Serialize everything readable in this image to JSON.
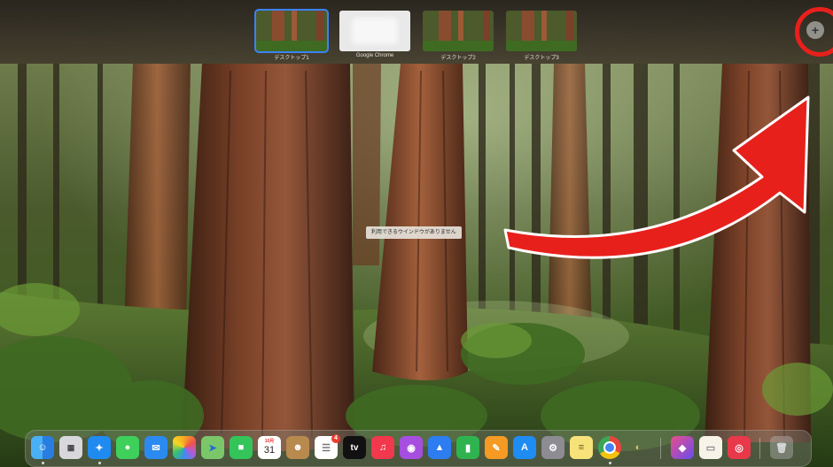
{
  "spaces_bar": {
    "spaces": [
      {
        "label": "デスクトップ1",
        "selected": true
      },
      {
        "label": "Google Chrome",
        "selected": false
      },
      {
        "label": "デスクトップ2",
        "selected": false
      },
      {
        "label": "デスクトップ3",
        "selected": false
      }
    ],
    "add_button_symbol": "+",
    "highlight_color": "#e8201c"
  },
  "tooltip": {
    "text": "利用できるウインドウがありません"
  },
  "dock": {
    "calendar_month": "10月",
    "calendar_day": "31",
    "reminders_badge": "4",
    "apple_tv_label": "tv",
    "apps": [
      {
        "name": "finder-icon"
      },
      {
        "name": "launchpad-icon"
      },
      {
        "name": "safari-icon"
      },
      {
        "name": "messages-icon"
      },
      {
        "name": "mail-icon"
      },
      {
        "name": "photos-icon"
      },
      {
        "name": "maps-icon"
      },
      {
        "name": "facetime-icon"
      },
      {
        "name": "calendar-icon"
      },
      {
        "name": "contacts-icon"
      },
      {
        "name": "reminders-icon"
      },
      {
        "name": "apple-tv-icon"
      },
      {
        "name": "music-icon"
      },
      {
        "name": "podcasts-icon"
      },
      {
        "name": "keynote-icon"
      },
      {
        "name": "numbers-icon"
      },
      {
        "name": "pages-icon"
      },
      {
        "name": "app-store-icon"
      },
      {
        "name": "system-settings-icon"
      },
      {
        "name": "notes-icon"
      },
      {
        "name": "chrome-icon"
      },
      {
        "name": "preview-icon"
      },
      {
        "name": "shortcuts-icon"
      },
      {
        "name": "textedit-icon"
      },
      {
        "name": "photo-booth-icon"
      },
      {
        "name": "trash-icon"
      }
    ]
  }
}
